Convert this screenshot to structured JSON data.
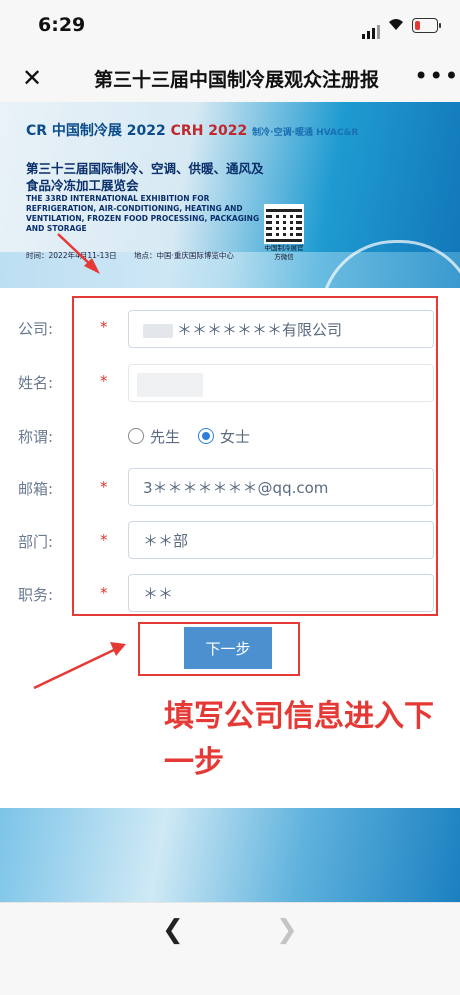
{
  "status_bar": {
    "time": "6:29"
  },
  "nav": {
    "title": "第三十三届中国制冷展观众注册报"
  },
  "banner": {
    "logo_cr": "CR 中国制冷展 2022",
    "logo_crh": "CRH 2022",
    "logo_hvac": "制冷·空调·暖通 HVAC&R",
    "title_line1": "第三十三届国际制冷、空调、供暖、通风及",
    "title_line2": "食品冷冻加工展览会",
    "title_en": "THE 33RD INTERNATIONAL EXHIBITION FOR REFRIGERATION, AIR-CONDITIONING, HEATING AND VENTILATION, FROZEN FOOD PROCESSING, PACKAGING AND STORAGE",
    "date": "时间：2022年4月11-13日",
    "place": "地点：中国·重庆国际博览中心",
    "qr_caption": "中国制冷展官方微信",
    "year_mark": "2022"
  },
  "form": {
    "company": {
      "label": "公司:",
      "required": "*",
      "value": "＊＊＊＊＊＊＊有限公司"
    },
    "name": {
      "label": "姓名:",
      "required": "*",
      "value": ""
    },
    "title": {
      "label": "称谓:",
      "options": [
        "先生",
        "女士"
      ],
      "selected": "女士"
    },
    "email": {
      "label": "邮箱:",
      "required": "*",
      "value": "3＊＊＊＊＊＊＊@qq.com"
    },
    "department": {
      "label": "部门:",
      "required": "*",
      "value": "＊＊部"
    },
    "position": {
      "label": "职务:",
      "required": "*",
      "value": "＊＊"
    },
    "next_button": "下一步"
  },
  "annotation": {
    "note": "填写公司信息进入下一步",
    "color": "#e53935"
  },
  "colors": {
    "accent": "#4d90cf",
    "required": "#d93a34"
  },
  "icons": [
    "close-icon",
    "more-icon",
    "back-icon",
    "forward-icon",
    "signal-icon",
    "wifi-icon",
    "battery-icon"
  ]
}
